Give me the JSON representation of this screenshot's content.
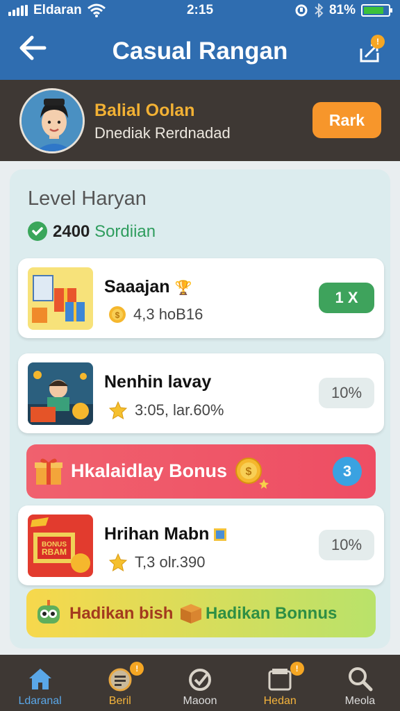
{
  "status_bar": {
    "carrier": "Eldaran",
    "time": "2:15",
    "battery_text": "81%",
    "battery_level": 0.81
  },
  "app_bar": {
    "title": "Casual Rangan",
    "share_badge": "!"
  },
  "profile": {
    "name": "Balial Oolan",
    "subtitle": "Dnediak Rerdnadad",
    "rank_button": "Rark"
  },
  "level": {
    "title": "Level Haryan",
    "coins_value": "2400",
    "coins_label": "Sordiian"
  },
  "cards": [
    {
      "name": "Saaajan",
      "meta": "4,3 hoB16",
      "action": "1 X"
    },
    {
      "name": "Nenhin lavay",
      "meta": "3:05, lar.60%",
      "action": "10%"
    },
    {
      "name": "Hrihan Mabn",
      "meta": "T,3 olr.390",
      "action": "10%"
    }
  ],
  "bonus_red": {
    "label": "Hkalaidlay Bonus",
    "count": "3"
  },
  "bonus_yellow": {
    "label_left": "Hadikan bish",
    "label_right": "Hadikan Bonnus"
  },
  "nav": [
    {
      "label": "Ldaranal",
      "icon": "home-icon"
    },
    {
      "label": "Beril",
      "icon": "list-icon",
      "badge": "!"
    },
    {
      "label": "Maoon",
      "icon": "check-icon"
    },
    {
      "label": "Hedan",
      "icon": "folder-icon",
      "badge": "!"
    },
    {
      "label": "Meola",
      "icon": "search-icon"
    }
  ],
  "colors": {
    "primary": "#2f6db0",
    "dark": "#3e3834",
    "accent_orange": "#f7962b",
    "green": "#3ea35c",
    "red_bonus": "#ee4d63",
    "blue_badge": "#3aa2e1"
  }
}
